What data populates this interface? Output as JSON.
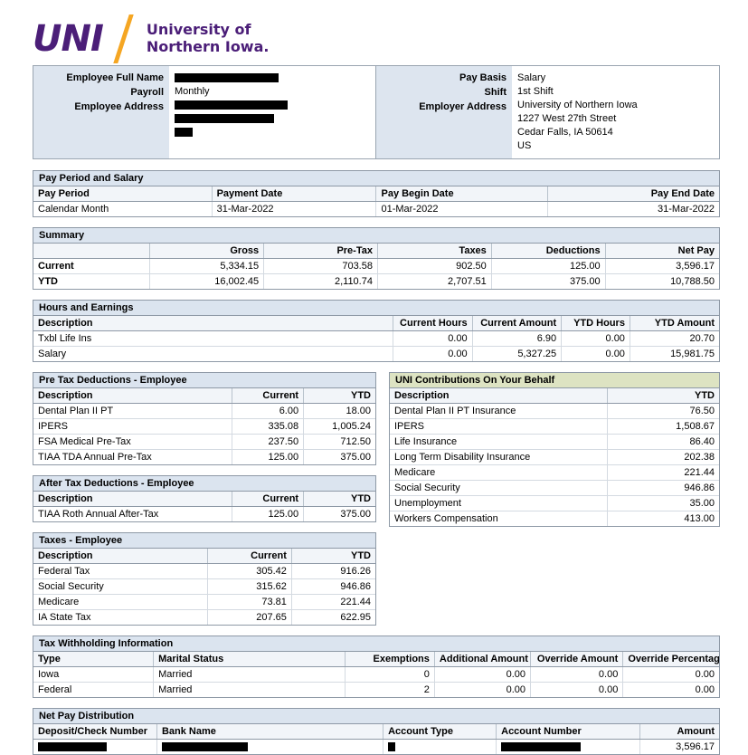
{
  "logo": {
    "mark": "UNI",
    "line1": "University of",
    "line2": "Northern Iowa."
  },
  "employee_panel": {
    "labels": {
      "full_name": "Employee Full Name",
      "payroll": "Payroll",
      "address": "Employee Address"
    },
    "payroll_value": "Monthly",
    "redacted": true
  },
  "employer_panel": {
    "labels": {
      "pay_basis": "Pay Basis",
      "shift": "Shift",
      "employer_address": "Employer Address"
    },
    "pay_basis": "Salary",
    "shift": "1st Shift",
    "address": [
      "University of Northern Iowa",
      "1227 West 27th Street",
      "Cedar Falls, IA 50614",
      "US"
    ]
  },
  "pay_period": {
    "title": "Pay Period and Salary",
    "headers": [
      "Pay Period",
      "Payment Date",
      "Pay Begin Date",
      "Pay End Date"
    ],
    "row": [
      "Calendar Month",
      "31-Mar-2022",
      "01-Mar-2022",
      "31-Mar-2022"
    ]
  },
  "summary": {
    "title": "Summary",
    "headers": [
      "",
      "Gross",
      "Pre-Tax",
      "Taxes",
      "Deductions",
      "Net Pay"
    ],
    "rows": [
      [
        "Current",
        "5,334.15",
        "703.58",
        "902.50",
        "125.00",
        "3,596.17"
      ],
      [
        "YTD",
        "16,002.45",
        "2,110.74",
        "2,707.51",
        "375.00",
        "10,788.50"
      ]
    ]
  },
  "hours_earnings": {
    "title": "Hours and Earnings",
    "headers": [
      "Description",
      "Current Hours",
      "Current Amount",
      "YTD Hours",
      "YTD Amount"
    ],
    "rows": [
      [
        "Txbl Life Ins",
        "0.00",
        "6.90",
        "0.00",
        "20.70"
      ],
      [
        "Salary",
        "0.00",
        "5,327.25",
        "0.00",
        "15,981.75"
      ]
    ]
  },
  "pre_tax_deductions": {
    "title": "Pre Tax Deductions - Employee",
    "headers": [
      "Description",
      "Current",
      "YTD"
    ],
    "rows": [
      [
        "Dental Plan II PT",
        "6.00",
        "18.00"
      ],
      [
        "IPERS",
        "335.08",
        "1,005.24"
      ],
      [
        "FSA Medical Pre-Tax",
        "237.50",
        "712.50"
      ],
      [
        "TIAA TDA Annual Pre-Tax",
        "125.00",
        "375.00"
      ]
    ]
  },
  "after_tax_deductions": {
    "title": "After Tax Deductions - Employee",
    "headers": [
      "Description",
      "Current",
      "YTD"
    ],
    "rows": [
      [
        "TIAA Roth Annual After-Tax",
        "125.00",
        "375.00"
      ]
    ]
  },
  "taxes_employee": {
    "title": "Taxes - Employee",
    "headers": [
      "Description",
      "Current",
      "YTD"
    ],
    "rows": [
      [
        "Federal Tax",
        "305.42",
        "916.26"
      ],
      [
        "Social Security",
        "315.62",
        "946.86"
      ],
      [
        "Medicare",
        "73.81",
        "221.44"
      ],
      [
        "IA State Tax",
        "207.65",
        "622.95"
      ]
    ]
  },
  "uni_contributions": {
    "title": "UNI Contributions On Your Behalf",
    "headers": [
      "Description",
      "YTD"
    ],
    "rows": [
      [
        "Dental Plan II PT Insurance",
        "76.50"
      ],
      [
        "IPERS",
        "1,508.67"
      ],
      [
        "Life Insurance",
        "86.40"
      ],
      [
        "Long Term Disability Insurance",
        "202.38"
      ],
      [
        "Medicare",
        "221.44"
      ],
      [
        "Social Security",
        "946.86"
      ],
      [
        "Unemployment",
        "35.00"
      ],
      [
        "Workers Compensation",
        "413.00"
      ]
    ]
  },
  "tax_withholding": {
    "title": "Tax Withholding Information",
    "headers": [
      "Type",
      "Marital Status",
      "Exemptions",
      "Additional Amount",
      "Override Amount",
      "Override Percentage"
    ],
    "rows": [
      [
        "Iowa",
        "Married",
        "0",
        "0.00",
        "0.00",
        "0.00"
      ],
      [
        "Federal",
        "Married",
        "2",
        "0.00",
        "0.00",
        "0.00"
      ]
    ]
  },
  "net_pay_distribution": {
    "title": "Net Pay Distribution",
    "headers": [
      "Deposit/Check Number",
      "Bank Name",
      "Account Type",
      "Account Number",
      "Amount"
    ],
    "row": {
      "deposit_check_number": "",
      "bank_name": "",
      "account_type": "",
      "account_number": "",
      "amount": "3,596.17"
    }
  },
  "colors": {
    "brand_purple": "#4b1e78",
    "brand_gold": "#f5a623",
    "section_header_blue": "#dbe4ef",
    "section_header_green": "#dde3c2",
    "label_panel_blue": "#dde5ef"
  }
}
